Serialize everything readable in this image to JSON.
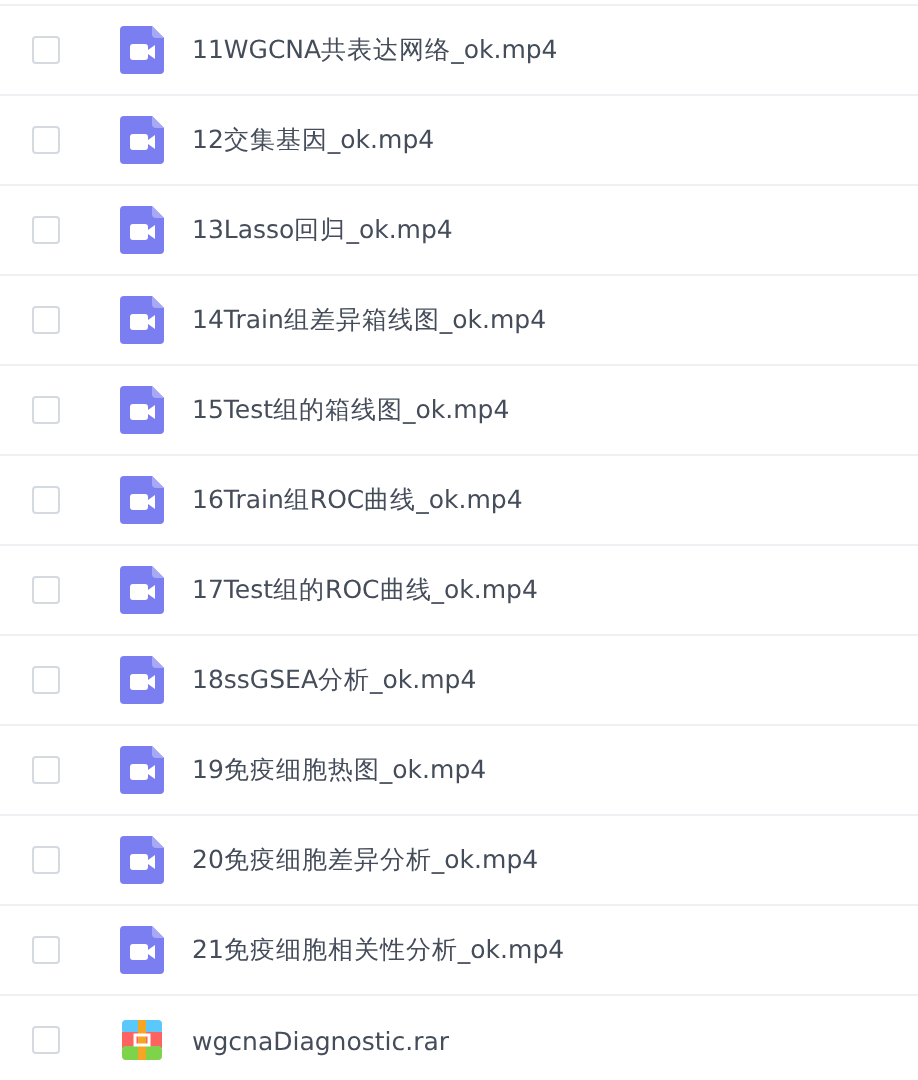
{
  "files": [
    {
      "name": "11WGCNA共表达网络_ok.mp4",
      "kind": "video",
      "checked": false
    },
    {
      "name": "12交集基因_ok.mp4",
      "kind": "video",
      "checked": false
    },
    {
      "name": "13Lasso回归_ok.mp4",
      "kind": "video",
      "checked": false
    },
    {
      "name": "14Train组差异箱线图_ok.mp4",
      "kind": "video",
      "checked": false
    },
    {
      "name": "15Test组的箱线图_ok.mp4",
      "kind": "video",
      "checked": false
    },
    {
      "name": "16Train组ROC曲线_ok.mp4",
      "kind": "video",
      "checked": false
    },
    {
      "name": "17Test组的ROC曲线_ok.mp4",
      "kind": "video",
      "checked": false
    },
    {
      "name": "18ssGSEA分析_ok.mp4",
      "kind": "video",
      "checked": false
    },
    {
      "name": "19免疫细胞热图_ok.mp4",
      "kind": "video",
      "checked": false
    },
    {
      "name": "20免疫细胞差异分析_ok.mp4",
      "kind": "video",
      "checked": false
    },
    {
      "name": "21免疫细胞相关性分析_ok.mp4",
      "kind": "video",
      "checked": false
    },
    {
      "name": "wgcnaDiagnostic.rar",
      "kind": "archive",
      "checked": false
    }
  ]
}
